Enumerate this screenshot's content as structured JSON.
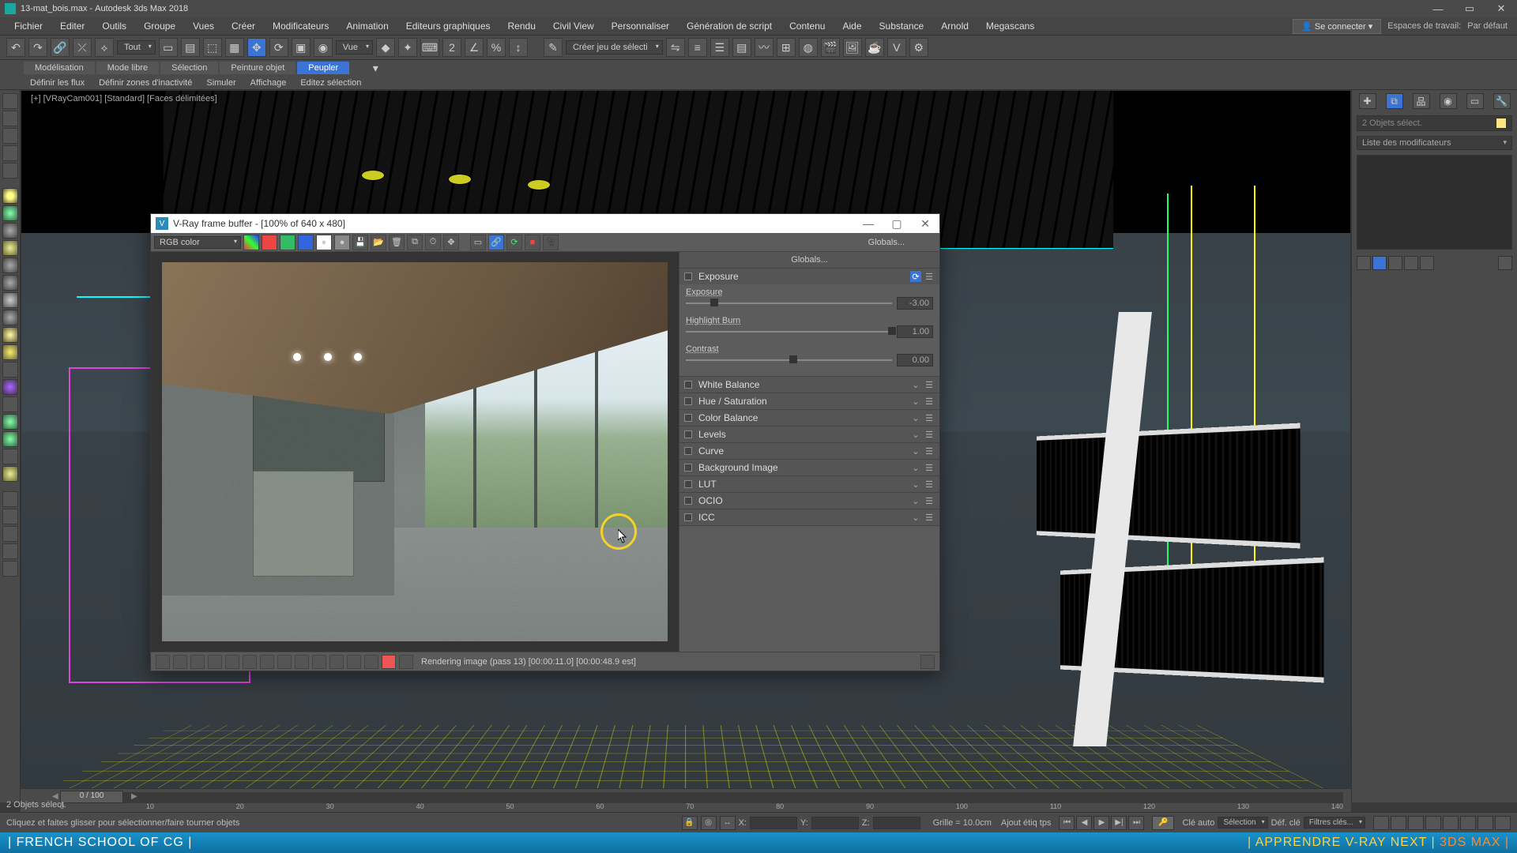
{
  "titlebar": {
    "filename": "13-mat_bois.max",
    "app": "Autodesk 3ds Max 2018"
  },
  "menubar": {
    "items": [
      "Fichier",
      "Editer",
      "Outils",
      "Groupe",
      "Vues",
      "Créer",
      "Modificateurs",
      "Animation",
      "Editeurs graphiques",
      "Rendu",
      "Civil View",
      "Personnaliser",
      "Génération de script",
      "Contenu",
      "Aide",
      "Substance",
      "Arnold",
      "Megascans"
    ],
    "signin_label": "Se connecter",
    "workspace_label": "Espaces de travail:",
    "workspace_value": "Par défaut"
  },
  "toolbar": {
    "filter_label": "Tout",
    "view_label": "Vue",
    "quickaccess_label": "Créer jeu de sélecti"
  },
  "ribbon": {
    "tabs": [
      "Modélisation",
      "Mode libre",
      "Sélection",
      "Peinture objet",
      "Peupler"
    ],
    "active_tab": "Peupler",
    "sub_items": [
      "Définir les flux",
      "Définir zones d'inactivité",
      "Simuler",
      "Affichage",
      "Editez sélection"
    ]
  },
  "viewport": {
    "label": "[+] [VRayCam001] [Standard] [Faces délimitées]"
  },
  "rightpanel": {
    "selection_text": "2 Objets sélect.",
    "modlist_label": "Liste des modificateurs"
  },
  "vfb": {
    "title": "V-Ray frame buffer - [100% of 640 x 480]",
    "channel": "RGB color",
    "globals": "Globals...",
    "sections": {
      "exposure": {
        "title": "Exposure",
        "params": [
          {
            "label": "Exposure",
            "value": "-3.00",
            "pos": 12
          },
          {
            "label": "Highlight Burn",
            "value": "1.00",
            "pos": 98
          },
          {
            "label": "Contrast",
            "value": "0.00",
            "pos": 50
          }
        ]
      },
      "others": [
        "White Balance",
        "Hue / Saturation",
        "Color Balance",
        "Levels",
        "Curve",
        "Background Image",
        "LUT",
        "OCIO",
        "ICC"
      ]
    },
    "status": "Rendering image (pass 13) [00:00:11.0] [00:00:48.9 est]"
  },
  "timeline": {
    "thumb": "0 / 100",
    "ticks": [
      "0",
      "10",
      "20",
      "30",
      "40",
      "50",
      "60",
      "70",
      "80",
      "90",
      "100",
      "110",
      "120",
      "130",
      "140"
    ]
  },
  "statusbar": {
    "sel_text": "2 Objets sélect.",
    "prompt": "Cliquez et faites glisser pour sélectionner/faire tourner objets",
    "x": "X:",
    "y": "Y:",
    "z": "Z:",
    "grid": "Grille = 10.0cm",
    "autokey": "Clé auto",
    "selset": "Sélection",
    "setkey": "Déf. clé",
    "keyfilter": "Filtres clés...",
    "addtag": "Ajout étiq tps"
  },
  "banner": {
    "left": "| FRENCH SCHOOL OF CG |",
    "right_a": "| APPRENDRE V-RAY NEXT |",
    "right_b": " 3DS MAX |"
  }
}
